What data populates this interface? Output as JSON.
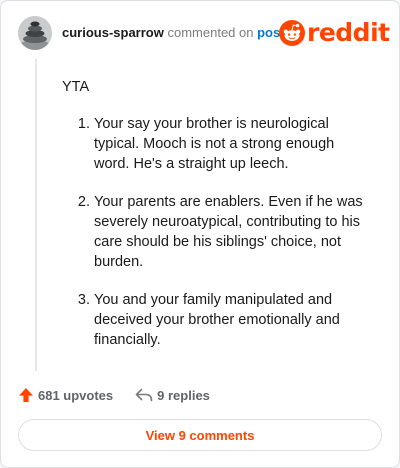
{
  "comment": {
    "username": "curious-sparrow",
    "action_text": "commented on",
    "post_link_label": "post",
    "avatar_icon": "stacked-stones-avatar"
  },
  "brand": {
    "wordmark": "reddit",
    "logo_icon": "reddit-snoo-icon",
    "color": "#ff4500"
  },
  "body": {
    "opener": "YTA",
    "points": [
      "Your say your brother is neurological typical. Mooch is not a strong enough word. He's a straight up leech.",
      "Your parents are enablers. Even if he was severely neuroatypical, contributing to his care should be his siblings' choice, not burden.",
      "You and your family manipulated and deceived your brother emotionally and financially."
    ]
  },
  "actions": {
    "upvotes_label": "681 upvotes",
    "upvote_icon": "upvote-arrow-icon",
    "replies_label": "9 replies",
    "reply_icon": "reply-arrow-icon"
  },
  "footer": {
    "view_comments_label": "View 9 comments"
  }
}
